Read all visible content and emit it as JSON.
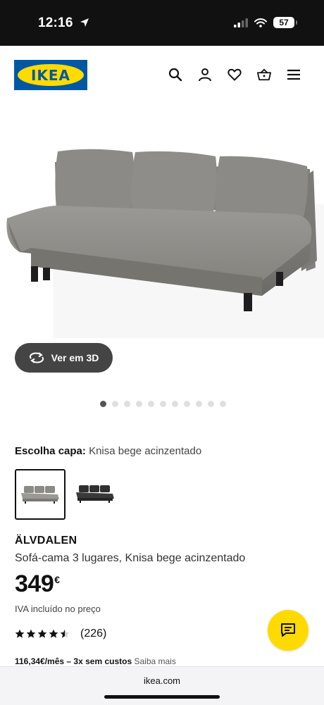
{
  "status_bar": {
    "time": "12:16",
    "battery": "57"
  },
  "header": {
    "logo_text": "IKEA"
  },
  "media": {
    "view_3d_label": "Ver em 3D",
    "slide_count": 11,
    "active_slide": 1
  },
  "cover": {
    "label": "Escolha capa:",
    "value": "Knisa bege acinzentado"
  },
  "product": {
    "name": "ÄLVDALEN",
    "description": "Sofá-cama 3 lugares, Knisa bege acinzentado",
    "price": "349",
    "currency": "€",
    "vat_note": "IVA incluído no preço",
    "rating_value": 4.5,
    "rating_count": "(226)",
    "installment_bold": "116,34€/mês – 3x sem custos",
    "installment_link": "Saiba mais"
  },
  "browser": {
    "url": "ikea.com"
  },
  "colors": {
    "ikea_blue": "#0058a3",
    "ikea_yellow": "#ffdb00",
    "chat_yellow": "#ffda00",
    "fabric_grey": "#8a8985",
    "fabric_dark": "#3a3a3a"
  },
  "icons": [
    "location-arrow-icon",
    "signal-icon",
    "wifi-icon",
    "battery-icon",
    "search-icon",
    "user-icon",
    "heart-icon",
    "basket-icon",
    "menu-icon",
    "rotate-3d-icon",
    "chat-icon"
  ]
}
